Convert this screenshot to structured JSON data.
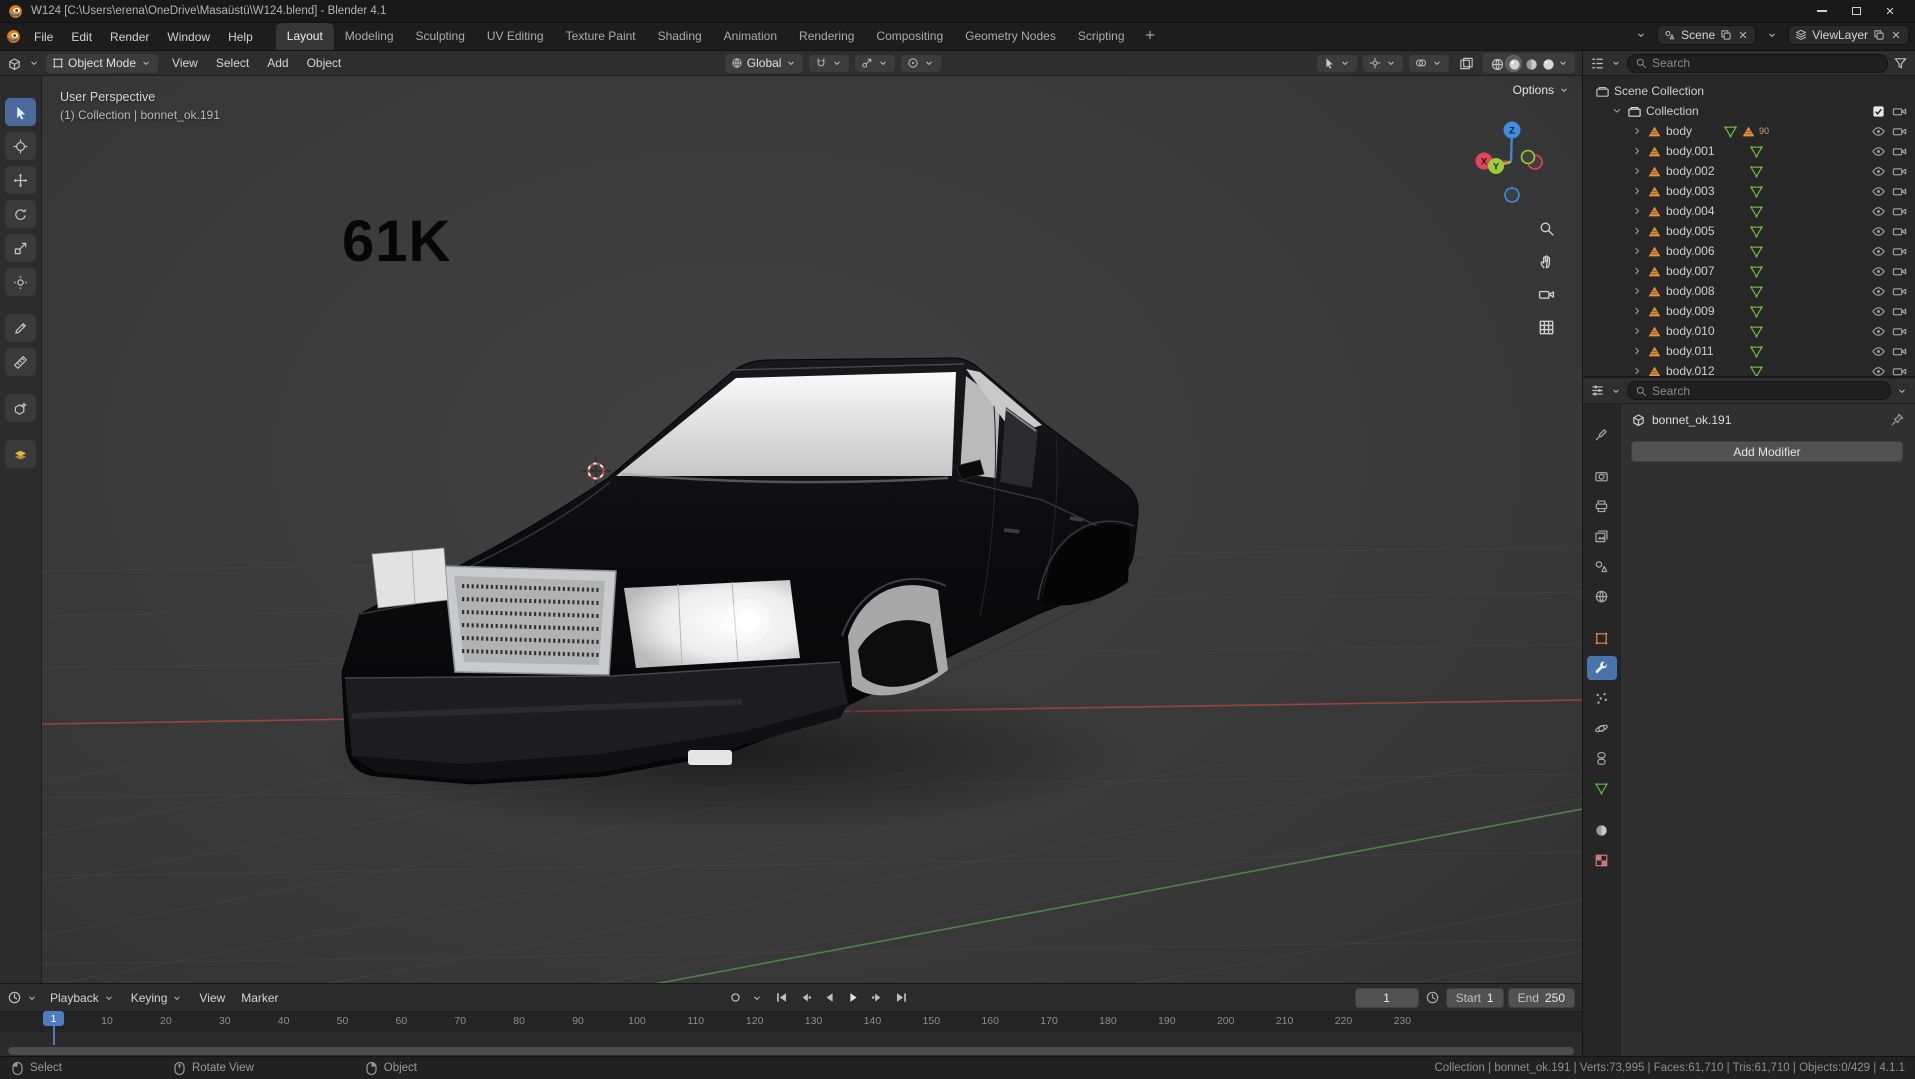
{
  "window": {
    "title": "W124 [C:\\Users\\erena\\OneDrive\\Masaüstü\\W124.blend] - Blender 4.1"
  },
  "topbar": {
    "menus": [
      "File",
      "Edit",
      "Render",
      "Window",
      "Help"
    ],
    "workspaces": [
      "Layout",
      "Modeling",
      "Sculpting",
      "UV Editing",
      "Texture Paint",
      "Shading",
      "Animation",
      "Rendering",
      "Compositing",
      "Geometry Nodes",
      "Scripting"
    ],
    "active_workspace": "Layout",
    "scene": "Scene",
    "view_layer": "ViewLayer"
  },
  "viewport_header": {
    "mode": "Object Mode",
    "menus": [
      "View",
      "Select",
      "Add",
      "Object"
    ],
    "orientation": "Global",
    "options_label": "Options"
  },
  "viewport": {
    "perspective_label": "User Perspective",
    "collection_label": "(1) Collection | bonnet_ok.191",
    "annotation": "61K",
    "axis_labels": {
      "x": "X",
      "y": "Y",
      "z": "Z"
    }
  },
  "toolbar": {
    "tools": [
      {
        "name": "select-box",
        "icon": "tsel",
        "active": true
      },
      {
        "name": "cursor",
        "icon": "tcur"
      },
      {
        "name": "move",
        "icon": "tmove"
      },
      {
        "name": "rotate",
        "icon": "trot"
      },
      {
        "name": "scale",
        "icon": "tscale"
      },
      {
        "name": "transform",
        "icon": "ttrans"
      },
      {
        "name": "annotate",
        "icon": "tpen",
        "gap": 12
      },
      {
        "name": "measure",
        "icon": "tmeas"
      },
      {
        "name": "add-cube",
        "icon": "tcube",
        "gap": 12
      },
      {
        "name": "extra-tool",
        "icon": "textra",
        "gap": 12
      }
    ]
  },
  "outliner": {
    "search_placeholder": "Search",
    "rows": [
      {
        "label": "Scene Collection",
        "type": "scene"
      },
      {
        "label": "Collection",
        "type": "collection"
      },
      {
        "label": "body",
        "type": "mesh",
        "badge": "90"
      },
      {
        "label": "body.001",
        "type": "mesh"
      },
      {
        "label": "body.002",
        "type": "mesh"
      },
      {
        "label": "body.003",
        "type": "mesh"
      },
      {
        "label": "body.004",
        "type": "mesh"
      },
      {
        "label": "body.005",
        "type": "mesh"
      },
      {
        "label": "body.006",
        "type": "mesh"
      },
      {
        "label": "body.007",
        "type": "mesh"
      },
      {
        "label": "body.008",
        "type": "mesh"
      },
      {
        "label": "body.009",
        "type": "mesh"
      },
      {
        "label": "body.010",
        "type": "mesh"
      },
      {
        "label": "body.011",
        "type": "mesh"
      },
      {
        "label": "body.012",
        "type": "mesh"
      }
    ]
  },
  "properties": {
    "search_placeholder": "Search",
    "breadcrumb": "bonnet_ok.191",
    "add_modifier_label": "Add Modifier",
    "active_tab": "modifiers",
    "tabs": [
      {
        "name": "tool",
        "icon": "tooltab"
      },
      {
        "name": "render",
        "icon": "render",
        "gap": 12
      },
      {
        "name": "output",
        "icon": "printer"
      },
      {
        "name": "view-layer",
        "icon": "layer"
      },
      {
        "name": "scene",
        "icon": "scn"
      },
      {
        "name": "world",
        "icon": "globe"
      },
      {
        "name": "object",
        "icon": "objsq",
        "color": "#d98f3e",
        "gap": 12
      },
      {
        "name": "modifiers",
        "icon": "wrench",
        "active": true
      },
      {
        "name": "particles",
        "icon": "parts"
      },
      {
        "name": "physics",
        "icon": "phys"
      },
      {
        "name": "constraints",
        "icon": "constr"
      },
      {
        "name": "data",
        "icon": "datatri",
        "color": "#5eb840"
      },
      {
        "name": "material",
        "icon": "smat",
        "gap": 12
      },
      {
        "name": "texture",
        "icon": "checker",
        "color": "#c97b7b"
      }
    ]
  },
  "timeline": {
    "menus": [
      {
        "label": "Playback",
        "dropdown": true
      },
      {
        "label": "Keying",
        "dropdown": true
      },
      {
        "label": "View"
      },
      {
        "label": "Marker"
      }
    ],
    "current_frame": "1",
    "start_label": "Start",
    "start_value": "1",
    "end_label": "End",
    "end_value": "250",
    "ticks": [
      "10",
      "20",
      "30",
      "40",
      "50",
      "60",
      "70",
      "80",
      "90",
      "100",
      "110",
      "120",
      "130",
      "140",
      "150",
      "160",
      "170",
      "180",
      "190",
      "200",
      "210",
      "220",
      "230"
    ]
  },
  "statusbar": {
    "hints": [
      {
        "icon": "mouseL",
        "label": "Select"
      },
      {
        "icon": "mouseM",
        "label": "Rotate View"
      },
      {
        "icon": "mouseR",
        "label": "Object"
      }
    ],
    "stats": [
      "Collection",
      "bonnet_ok.191",
      "Verts:73,995",
      "Faces:61,710",
      "Tris:61,710",
      "Objects:0/429",
      "4.1.1"
    ]
  }
}
